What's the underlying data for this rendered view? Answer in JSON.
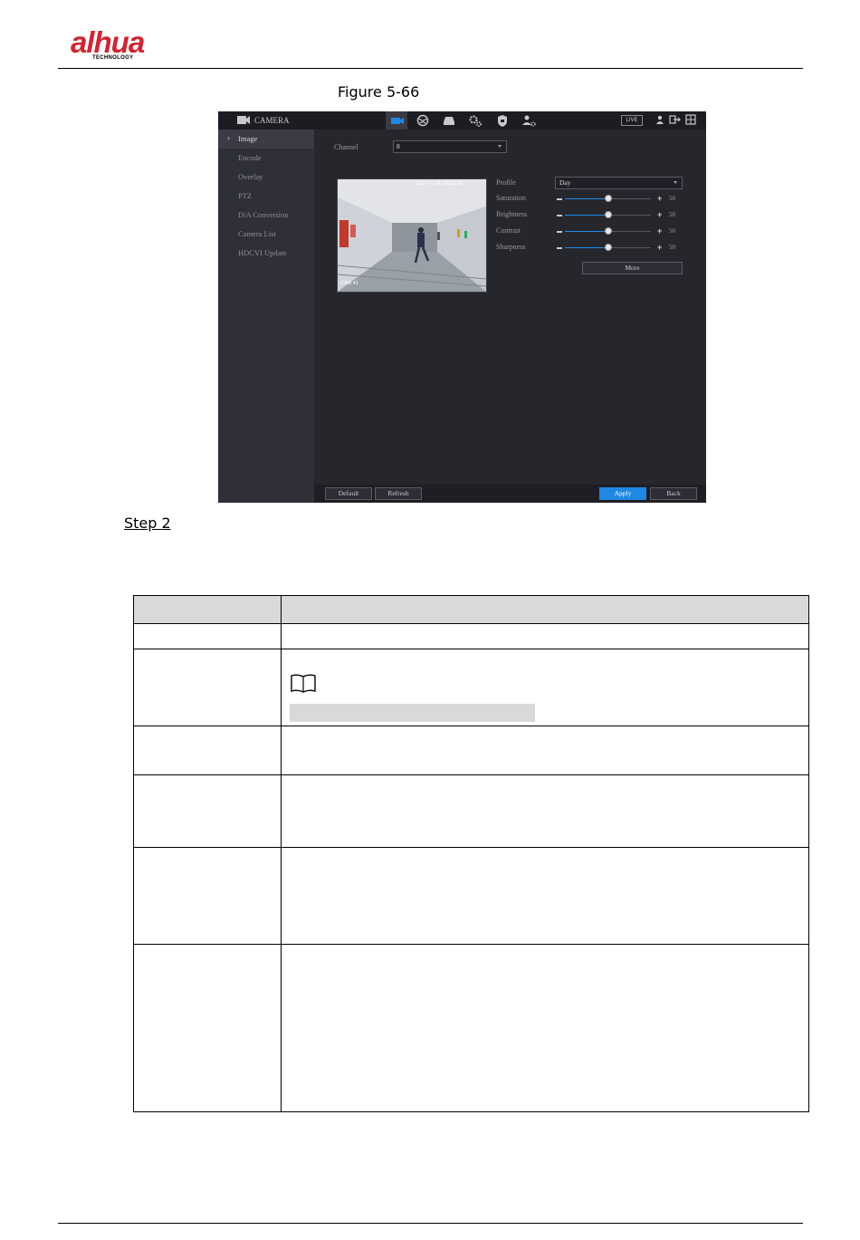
{
  "header": {
    "logo_text": "alhua",
    "logo_subtext": "TECHNOLOGY",
    "logo_color": "#d3242f"
  },
  "figure": {
    "caption": "Figure 5-66"
  },
  "screenshot": {
    "title": "CAMERA",
    "live_badge": "LIVE",
    "topbar_icons": [
      "camera-icon",
      "network-icon",
      "storage-icon",
      "system-settings-icon",
      "security-shield-icon",
      "account-settings-icon"
    ],
    "sidebar": {
      "items": [
        {
          "label": "Image",
          "active": true
        },
        {
          "label": "Encode",
          "active": false
        },
        {
          "label": "Overlay",
          "active": false
        },
        {
          "label": "PTZ",
          "active": false
        },
        {
          "label": "D/A Conversion",
          "active": false
        },
        {
          "label": "Camera List",
          "active": false
        },
        {
          "label": "HDCVI Update",
          "active": false
        }
      ]
    },
    "channel": {
      "label": "Channel",
      "value": "8"
    },
    "preview": {
      "timestamp": "2017-11-06 09:33:36",
      "channel_tag": "CAM 41"
    },
    "profile": {
      "label": "Profile",
      "value": "Day"
    },
    "sliders": [
      {
        "label": "Saturation",
        "value": 50
      },
      {
        "label": "Brightness",
        "value": 50
      },
      {
        "label": "Contrast",
        "value": 50
      },
      {
        "label": "Sharpness",
        "value": 50
      }
    ],
    "more_button": "More",
    "buttons": {
      "default": "Default",
      "refresh": "Refresh",
      "apply": "Apply",
      "back": "Back"
    },
    "accent_color": "#1e88e5"
  },
  "step": {
    "label": "Step 2"
  }
}
